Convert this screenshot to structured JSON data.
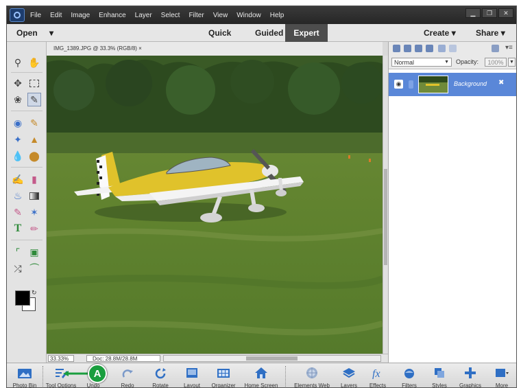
{
  "menubar": {
    "items": [
      "File",
      "Edit",
      "Image",
      "Enhance",
      "Layer",
      "Select",
      "Filter",
      "View",
      "Window",
      "Help"
    ]
  },
  "modebar": {
    "open": "Open",
    "quick": "Quick",
    "guided": "Guided",
    "expert": "Expert",
    "create": "Create",
    "share": "Share",
    "caret": "▾"
  },
  "document": {
    "tab_title": "IMG_1389.JPG @ 33.3% (RGB/8) ×",
    "zoom": "33.33%",
    "doc_size": "Doc: 28.8M/28.8M"
  },
  "layers": {
    "blend_mode": "Normal",
    "opacity_label": "Opacity:",
    "opacity_value": "100%",
    "layer_name": "Background"
  },
  "bottombar": {
    "items": [
      "Photo Bin",
      "Tool Options",
      "Undo",
      "Redo",
      "Rotate",
      "Layout",
      "Organizer",
      "Home Screen",
      "Elements Web",
      "Layers",
      "Effects",
      "Filters",
      "Styles",
      "Graphics",
      "More"
    ]
  },
  "callout": {
    "label": "A"
  },
  "colors": {
    "accent": "#5a87d8",
    "callout": "#1a9e3e",
    "expert_tab": "#4d4d4d"
  }
}
